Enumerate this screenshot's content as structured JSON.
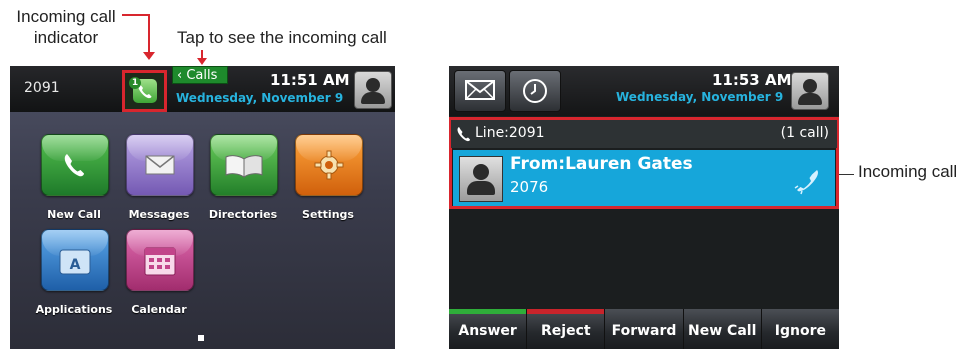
{
  "callouts": {
    "incoming_indicator": "Incoming call\nindicator",
    "tap_hint": "Tap to see the incoming call",
    "incoming_call": "Incoming call"
  },
  "left_phone": {
    "extension": "2091",
    "calls_tab": "‹ Calls",
    "indicator_count": "1",
    "time": "11:51 AM",
    "date": "Wednesday, November 9",
    "apps": [
      {
        "label": "New Call",
        "icon": "phone-icon",
        "color": "#2f9c3f"
      },
      {
        "label": "Messages",
        "icon": "envelope-icon",
        "color": "#9b82cc"
      },
      {
        "label": "Directories",
        "icon": "book-icon",
        "color": "#3f9c3f"
      },
      {
        "label": "Settings",
        "icon": "gear-icon",
        "color": "#f07e1a"
      },
      {
        "label": "Applications",
        "icon": "applications-icon",
        "color": "#2f7fc8"
      },
      {
        "label": "Calendar",
        "icon": "calendar-icon",
        "color": "#c2448a"
      }
    ]
  },
  "right_phone": {
    "time": "11:53 AM",
    "date": "Wednesday, November 9",
    "line_label": "Line:2091",
    "call_count": "(1 call)",
    "caller": "From:Lauren Gates",
    "caller_number": "2076",
    "softkeys": [
      {
        "label": "Answer",
        "bar": "#2fae3a"
      },
      {
        "label": "Reject",
        "bar": "#c9242b"
      },
      {
        "label": "Forward",
        "bar": ""
      },
      {
        "label": "New Call",
        "bar": ""
      },
      {
        "label": "Ignore",
        "bar": ""
      }
    ]
  },
  "colors": {
    "annotation_red": "#d8262e",
    "accent_blue": "#27b3de",
    "call_highlight": "#16a6da"
  }
}
